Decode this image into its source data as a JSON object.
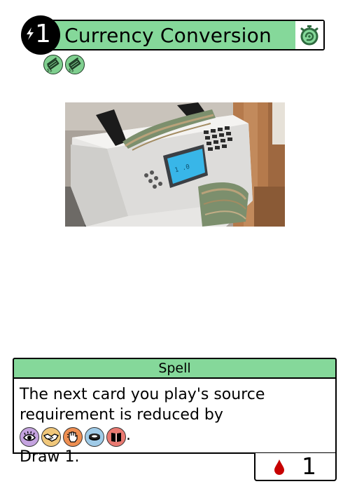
{
  "card": {
    "cost": "1",
    "title": "Currency Conversion",
    "type_line": "Spell",
    "text": {
      "line1": "The next card you play's source",
      "line2_start": "requirement is reduced by",
      "line2_end": ".",
      "line3": "Draw 1."
    },
    "stat": "1"
  },
  "icons": {
    "cost": "lightning-bolt-icon",
    "title_end": "stopwatch-icon",
    "tokens": [
      "money-stack-icon",
      "money-stack-icon"
    ],
    "source_requirements": [
      {
        "name": "eye-icon",
        "color": "#c4a3df"
      },
      {
        "name": "handshake-icon",
        "color": "#f0c77a"
      },
      {
        "name": "fist-icon",
        "color": "#ef8f52"
      },
      {
        "name": "ring-icon",
        "color": "#9fcbe8"
      },
      {
        "name": "book-icon",
        "color": "#ea7a72"
      }
    ],
    "stat": "blood-drop-icon"
  },
  "colors": {
    "accent": "#85d89a",
    "blood": "#c70000"
  },
  "art": {
    "subject": "money-counting-machine"
  }
}
